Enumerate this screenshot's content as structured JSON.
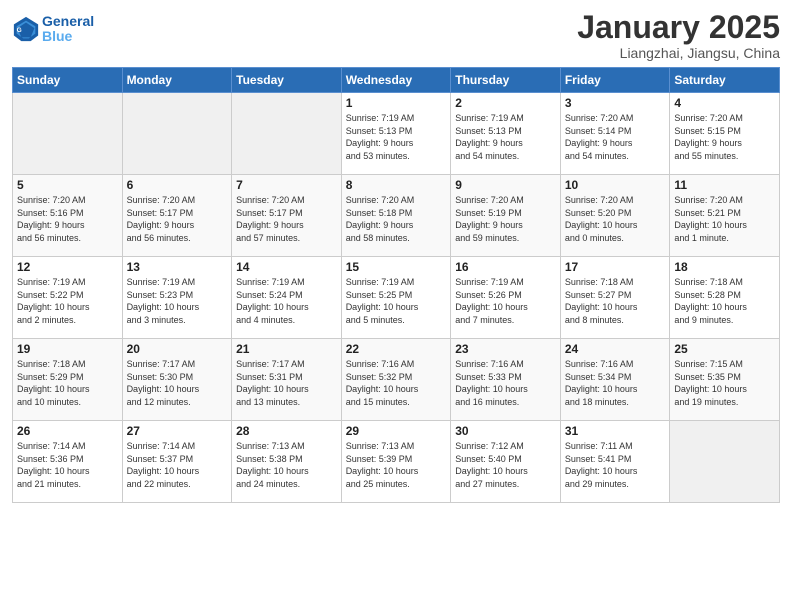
{
  "header": {
    "logo_line1": "General",
    "logo_line2": "Blue",
    "month": "January 2025",
    "location": "Liangzhai, Jiangsu, China"
  },
  "days_of_week": [
    "Sunday",
    "Monday",
    "Tuesday",
    "Wednesday",
    "Thursday",
    "Friday",
    "Saturday"
  ],
  "weeks": [
    [
      {
        "day": "",
        "info": ""
      },
      {
        "day": "",
        "info": ""
      },
      {
        "day": "",
        "info": ""
      },
      {
        "day": "1",
        "info": "Sunrise: 7:19 AM\nSunset: 5:13 PM\nDaylight: 9 hours\nand 53 minutes."
      },
      {
        "day": "2",
        "info": "Sunrise: 7:19 AM\nSunset: 5:13 PM\nDaylight: 9 hours\nand 54 minutes."
      },
      {
        "day": "3",
        "info": "Sunrise: 7:20 AM\nSunset: 5:14 PM\nDaylight: 9 hours\nand 54 minutes."
      },
      {
        "day": "4",
        "info": "Sunrise: 7:20 AM\nSunset: 5:15 PM\nDaylight: 9 hours\nand 55 minutes."
      }
    ],
    [
      {
        "day": "5",
        "info": "Sunrise: 7:20 AM\nSunset: 5:16 PM\nDaylight: 9 hours\nand 56 minutes."
      },
      {
        "day": "6",
        "info": "Sunrise: 7:20 AM\nSunset: 5:17 PM\nDaylight: 9 hours\nand 56 minutes."
      },
      {
        "day": "7",
        "info": "Sunrise: 7:20 AM\nSunset: 5:17 PM\nDaylight: 9 hours\nand 57 minutes."
      },
      {
        "day": "8",
        "info": "Sunrise: 7:20 AM\nSunset: 5:18 PM\nDaylight: 9 hours\nand 58 minutes."
      },
      {
        "day": "9",
        "info": "Sunrise: 7:20 AM\nSunset: 5:19 PM\nDaylight: 9 hours\nand 59 minutes."
      },
      {
        "day": "10",
        "info": "Sunrise: 7:20 AM\nSunset: 5:20 PM\nDaylight: 10 hours\nand 0 minutes."
      },
      {
        "day": "11",
        "info": "Sunrise: 7:20 AM\nSunset: 5:21 PM\nDaylight: 10 hours\nand 1 minute."
      }
    ],
    [
      {
        "day": "12",
        "info": "Sunrise: 7:19 AM\nSunset: 5:22 PM\nDaylight: 10 hours\nand 2 minutes."
      },
      {
        "day": "13",
        "info": "Sunrise: 7:19 AM\nSunset: 5:23 PM\nDaylight: 10 hours\nand 3 minutes."
      },
      {
        "day": "14",
        "info": "Sunrise: 7:19 AM\nSunset: 5:24 PM\nDaylight: 10 hours\nand 4 minutes."
      },
      {
        "day": "15",
        "info": "Sunrise: 7:19 AM\nSunset: 5:25 PM\nDaylight: 10 hours\nand 5 minutes."
      },
      {
        "day": "16",
        "info": "Sunrise: 7:19 AM\nSunset: 5:26 PM\nDaylight: 10 hours\nand 7 minutes."
      },
      {
        "day": "17",
        "info": "Sunrise: 7:18 AM\nSunset: 5:27 PM\nDaylight: 10 hours\nand 8 minutes."
      },
      {
        "day": "18",
        "info": "Sunrise: 7:18 AM\nSunset: 5:28 PM\nDaylight: 10 hours\nand 9 minutes."
      }
    ],
    [
      {
        "day": "19",
        "info": "Sunrise: 7:18 AM\nSunset: 5:29 PM\nDaylight: 10 hours\nand 10 minutes."
      },
      {
        "day": "20",
        "info": "Sunrise: 7:17 AM\nSunset: 5:30 PM\nDaylight: 10 hours\nand 12 minutes."
      },
      {
        "day": "21",
        "info": "Sunrise: 7:17 AM\nSunset: 5:31 PM\nDaylight: 10 hours\nand 13 minutes."
      },
      {
        "day": "22",
        "info": "Sunrise: 7:16 AM\nSunset: 5:32 PM\nDaylight: 10 hours\nand 15 minutes."
      },
      {
        "day": "23",
        "info": "Sunrise: 7:16 AM\nSunset: 5:33 PM\nDaylight: 10 hours\nand 16 minutes."
      },
      {
        "day": "24",
        "info": "Sunrise: 7:16 AM\nSunset: 5:34 PM\nDaylight: 10 hours\nand 18 minutes."
      },
      {
        "day": "25",
        "info": "Sunrise: 7:15 AM\nSunset: 5:35 PM\nDaylight: 10 hours\nand 19 minutes."
      }
    ],
    [
      {
        "day": "26",
        "info": "Sunrise: 7:14 AM\nSunset: 5:36 PM\nDaylight: 10 hours\nand 21 minutes."
      },
      {
        "day": "27",
        "info": "Sunrise: 7:14 AM\nSunset: 5:37 PM\nDaylight: 10 hours\nand 22 minutes."
      },
      {
        "day": "28",
        "info": "Sunrise: 7:13 AM\nSunset: 5:38 PM\nDaylight: 10 hours\nand 24 minutes."
      },
      {
        "day": "29",
        "info": "Sunrise: 7:13 AM\nSunset: 5:39 PM\nDaylight: 10 hours\nand 25 minutes."
      },
      {
        "day": "30",
        "info": "Sunrise: 7:12 AM\nSunset: 5:40 PM\nDaylight: 10 hours\nand 27 minutes."
      },
      {
        "day": "31",
        "info": "Sunrise: 7:11 AM\nSunset: 5:41 PM\nDaylight: 10 hours\nand 29 minutes."
      },
      {
        "day": "",
        "info": ""
      }
    ]
  ]
}
